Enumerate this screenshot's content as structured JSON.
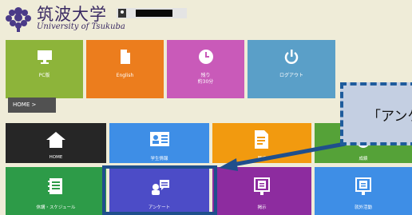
{
  "header": {
    "logo_jp": "筑波大学",
    "logo_en": "University of Tsukuba"
  },
  "top_tiles": [
    {
      "label": "PC版",
      "icon": "monitor-icon",
      "color": "#8db43a"
    },
    {
      "label": "English",
      "icon": "document-icon",
      "color": "#ec7d1d"
    },
    {
      "label_line1": "残り",
      "label_line2": "約30分",
      "icon": "clock-icon",
      "color": "#c95ab9"
    },
    {
      "label": "ログアウト",
      "icon": "power-icon",
      "color": "#5a9fc8"
    }
  ],
  "breadcrumb": {
    "label": "HOME >"
  },
  "menu_row1": [
    {
      "label": "HOME",
      "icon": "home-icon",
      "color": "#262626"
    },
    {
      "label": "学生情報",
      "icon": "id-card-icon",
      "color": "#3e8ee6"
    },
    {
      "label": "履修",
      "icon": "document-pen-icon",
      "color": "#f29a0f"
    },
    {
      "label": "成績",
      "icon": "grade-icon",
      "color": "#55a238"
    }
  ],
  "menu_row2": [
    {
      "label": "休講・スケジュール",
      "icon": "notebook-icon",
      "color": "#2d9b48"
    },
    {
      "label": "アンケート",
      "icon": "survey-icon",
      "color": "#4c4cc7"
    },
    {
      "label": "掲示",
      "icon": "board-icon",
      "color": "#8d2c9f"
    },
    {
      "label": "就外活動",
      "icon": "board-icon",
      "color": "#3e8ee6"
    }
  ],
  "callout": {
    "text": "「アンケ"
  }
}
